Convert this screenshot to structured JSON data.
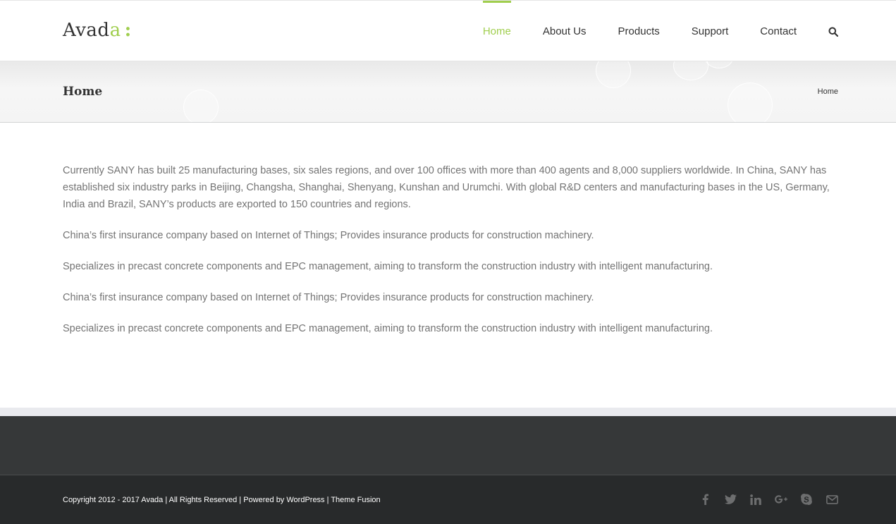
{
  "logo": {
    "text": "Avad",
    "accent": "a",
    "mark": ":"
  },
  "nav": {
    "items": [
      "Home",
      "About Us",
      "Products",
      "Support",
      "Contact"
    ],
    "search_icon": "search-icon"
  },
  "page": {
    "title": "Home",
    "breadcrumb": "Home"
  },
  "content": {
    "paragraphs": [
      "Currently SANY has built 25 manufacturing bases, six sales regions, and over 100 offices with more than 400 agents and 8,000 suppliers worldwide. In China, SANY has established six industry parks in Beijing, Changsha, Shanghai, Shenyang, Kunshan and Urumchi. With global R&D centers and manufacturing bases in the US, Germany, India and Brazil, SANY’s products are exported to 150 countries and regions.",
      "China’s first insurance company based on Internet of Things; Provides insurance products for construction machinery.",
      "Specializes in precast concrete components and EPC management, aiming to transform the construction industry with intelligent manufacturing.",
      "China’s first insurance company based on Internet of Things; Provides insurance products for construction machinery.",
      "Specializes in precast concrete components and EPC management, aiming to transform the construction industry with intelligent manufacturing."
    ]
  },
  "footer": {
    "copyright": "Copyright 2012 - 2017 Avada | All Rights Reserved | Powered by WordPress | Theme Fusion",
    "social_icons": [
      "facebook-icon",
      "twitter-icon",
      "linkedin-icon",
      "google-plus-icon",
      "skype-icon",
      "email-icon"
    ]
  },
  "colors": {
    "accent": "#a0ce4e",
    "footer_widgets": "#363839",
    "footer_bottom": "#282a2b",
    "body_text": "#747474"
  }
}
